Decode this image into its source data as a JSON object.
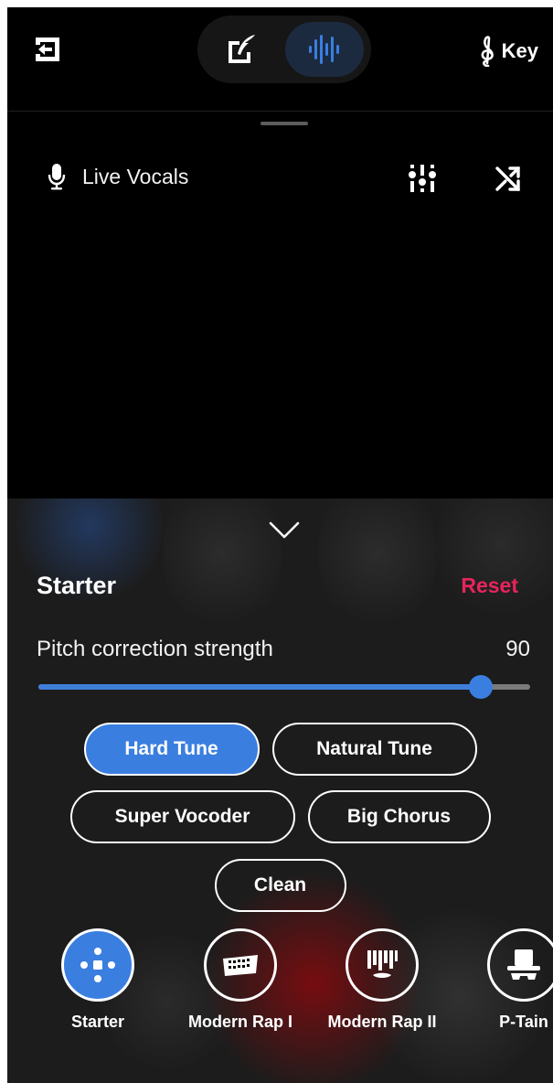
{
  "header": {
    "key_label": "Key",
    "modes": [
      "write-mode",
      "record-mode"
    ],
    "active_mode": "record-mode"
  },
  "track": {
    "label": "Live Vocals"
  },
  "panel": {
    "preset_title": "Starter",
    "reset_label": "Reset",
    "slider": {
      "label": "Pitch correction strength",
      "value": 90,
      "min": 0,
      "max": 100,
      "display_value": "90"
    },
    "chips": [
      {
        "label": "Hard Tune",
        "active": true
      },
      {
        "label": "Natural Tune",
        "active": false
      },
      {
        "label": "Super Vocoder",
        "active": false
      },
      {
        "label": "Big Chorus",
        "active": false
      },
      {
        "label": "Clean",
        "active": false
      }
    ],
    "presets": [
      {
        "name": "Starter",
        "icon": "starter-icon",
        "active": true
      },
      {
        "name": "Modern Rap I",
        "icon": "harmonica-icon",
        "active": false
      },
      {
        "name": "Modern Rap II",
        "icon": "pipes-icon",
        "active": false
      },
      {
        "name": "P-Tain",
        "icon": "top-hat-icon",
        "active": false
      }
    ]
  },
  "colors": {
    "accent": "#3a7ee0",
    "reset": "#e8245c",
    "background": "#000000",
    "panel": "#1c1c1c"
  }
}
